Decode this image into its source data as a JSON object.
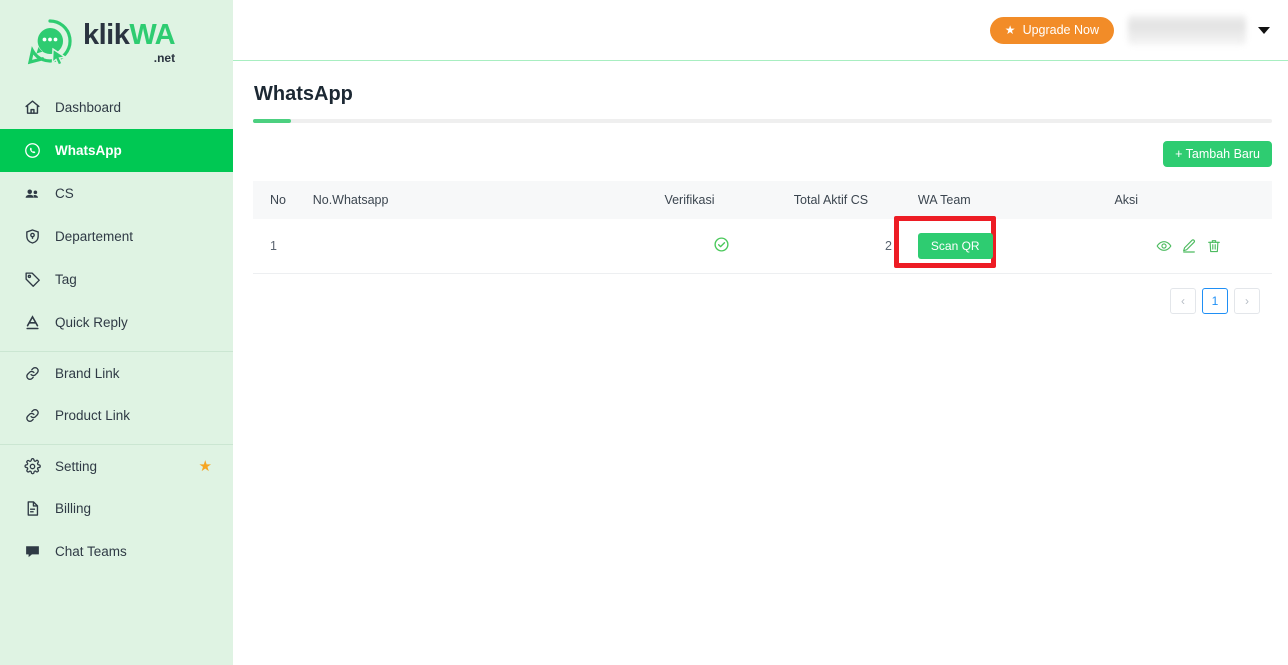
{
  "brand": {
    "logo_klik": "klik",
    "logo_wa": "WA",
    "logo_tld": ".net",
    "logo_icon": "chat-bubble-cursor-icon"
  },
  "sidebar": {
    "items": [
      {
        "label": "Dashboard",
        "icon": "home-icon",
        "active": false,
        "star": false,
        "divider": false
      },
      {
        "label": "WhatsApp",
        "icon": "whatsapp-icon",
        "active": true,
        "star": false,
        "divider": false
      },
      {
        "label": "CS",
        "icon": "people-icon",
        "active": false,
        "star": false,
        "divider": false
      },
      {
        "label": "Departement",
        "icon": "shield-icon",
        "active": false,
        "star": false,
        "divider": false
      },
      {
        "label": "Tag",
        "icon": "tag-icon",
        "active": false,
        "star": false,
        "divider": false
      },
      {
        "label": "Quick Reply",
        "icon": "text-a-icon",
        "active": false,
        "star": false,
        "divider": false
      },
      {
        "label": "Brand Link",
        "icon": "link-icon",
        "active": false,
        "star": false,
        "divider": true
      },
      {
        "label": "Product Link",
        "icon": "link-icon",
        "active": false,
        "star": false,
        "divider": false
      },
      {
        "label": "Setting",
        "icon": "gear-icon",
        "active": false,
        "star": true,
        "divider": true
      },
      {
        "label": "Billing",
        "icon": "document-icon",
        "active": false,
        "star": false,
        "divider": false
      },
      {
        "label": "Chat Teams",
        "icon": "chat-icon",
        "active": false,
        "star": false,
        "divider": false
      }
    ]
  },
  "topbar": {
    "upgrade_label": "Upgrade Now",
    "upgrade_icon": "star-icon",
    "upgrade_color": "#F28C28",
    "user_name": "",
    "caret_icon": "chevron-down-icon"
  },
  "page": {
    "title": "WhatsApp",
    "accent_color": "#4CD080"
  },
  "toolbar": {
    "add_label": "+ Tambah Baru",
    "add_color": "#2ECC71"
  },
  "table": {
    "columns": [
      "No",
      "No.Whatsapp",
      "Verifikasi",
      "Total Aktif CS",
      "WA Team",
      "Aksi"
    ],
    "rows": [
      {
        "no": "1",
        "whatsapp": "",
        "verifikasi_icon": "check-circle-icon",
        "total_aktif_cs": "2",
        "wa_team_label": "Scan QR",
        "actions": [
          "eye-icon",
          "pencil-icon",
          "trash-icon"
        ]
      }
    ]
  },
  "annotation": {
    "target": "scan-qr-button",
    "color": "#ED1C24"
  },
  "pagination": {
    "prev": "‹",
    "pages": [
      "1"
    ],
    "next": "›",
    "active_page": "1",
    "active_color": "#1F8FF5"
  }
}
